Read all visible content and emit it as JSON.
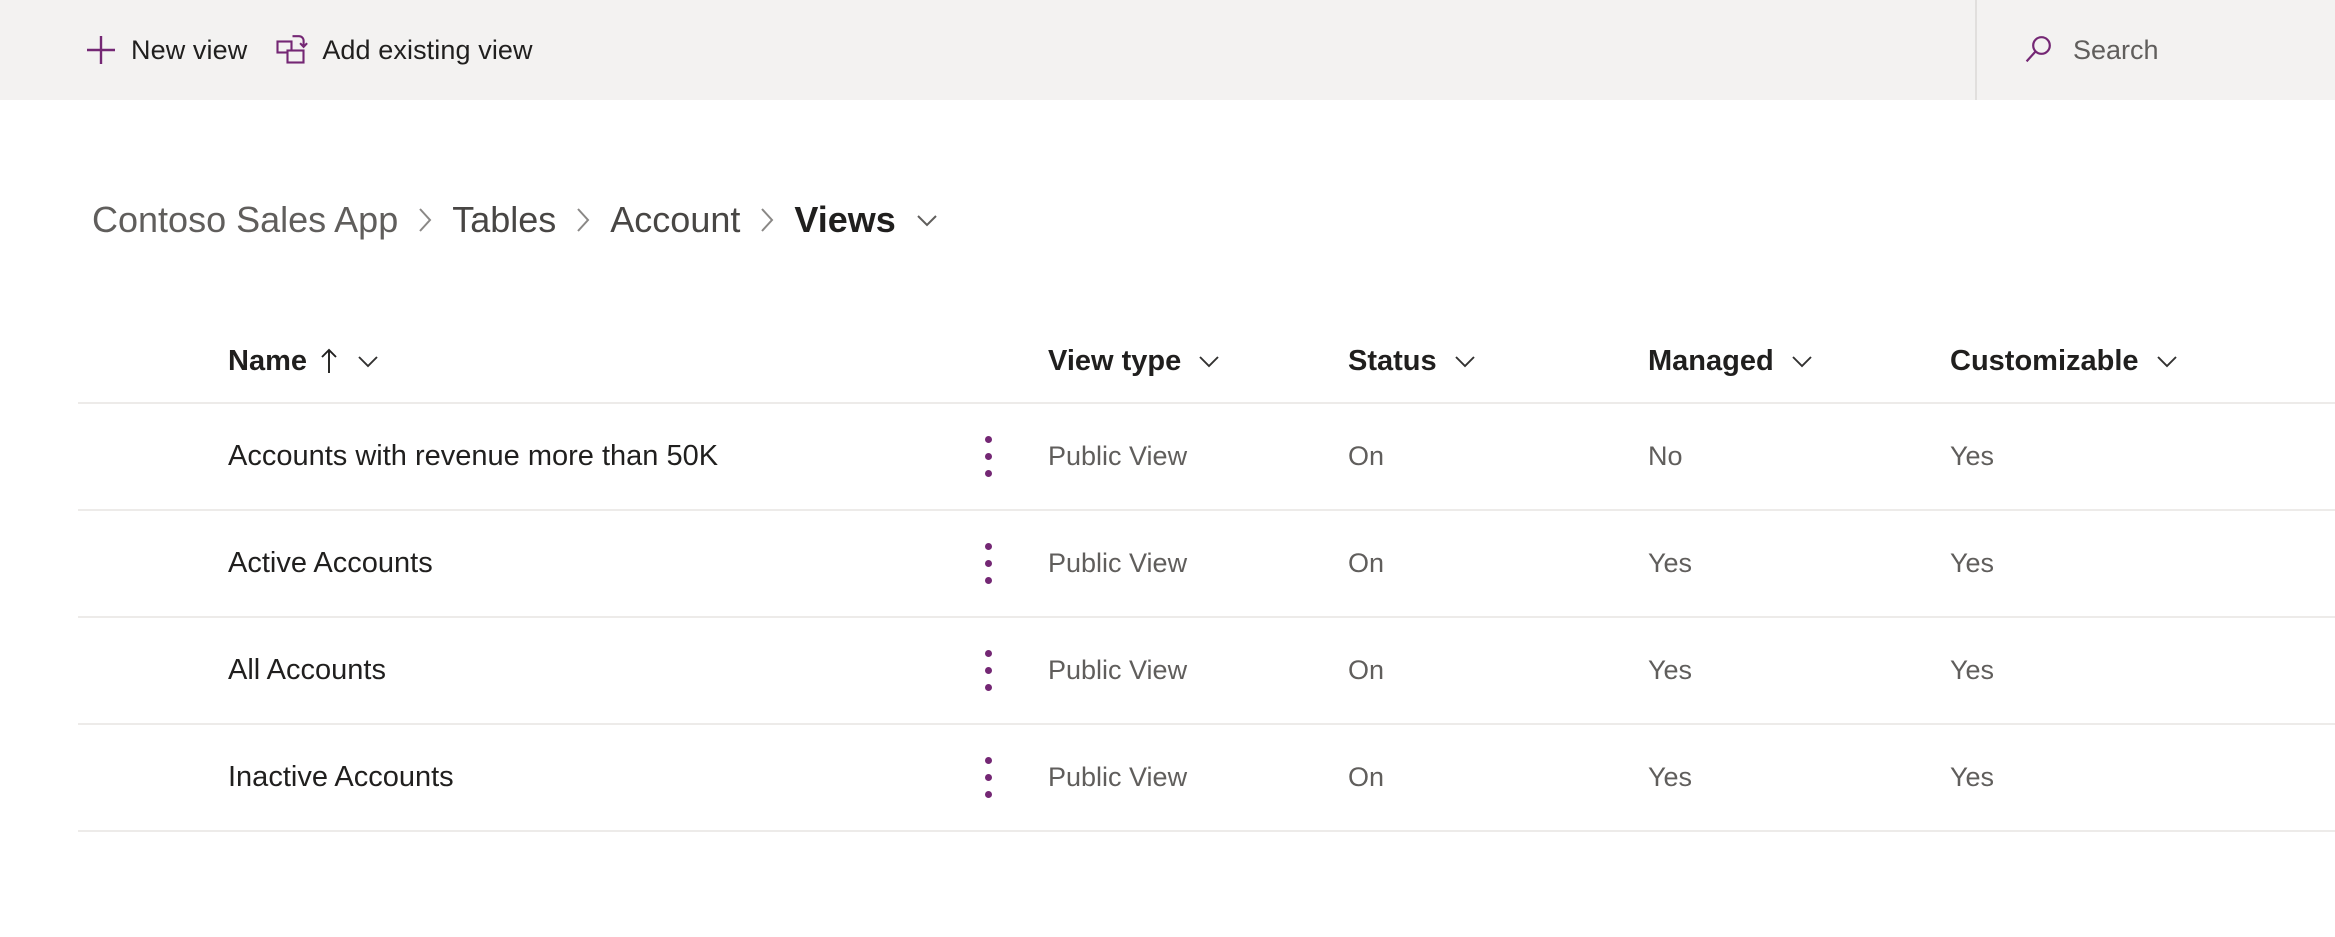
{
  "commandbar": {
    "new_view": {
      "label": "New view",
      "icon": "plus-icon"
    },
    "add_existing_view": {
      "label": "Add existing view",
      "icon": "add-existing-view-icon"
    },
    "search": {
      "placeholder": "Search",
      "value": "",
      "icon": "search-icon"
    },
    "background": "#f3f2f1",
    "accent": "#742774"
  },
  "breadcrumb": {
    "items": [
      {
        "label": "Contoso Sales App"
      },
      {
        "label": "Tables"
      },
      {
        "label": "Account"
      },
      {
        "label": "Views"
      }
    ],
    "separator": "›",
    "current_chevron": "chevron-down-icon"
  },
  "table": {
    "columns": [
      {
        "label": "Name",
        "sort": "ascending",
        "sort_icon": "arrow-up-icon",
        "chevron": "chevron-down-icon"
      },
      {
        "label": "View type",
        "chevron": "chevron-down-icon"
      },
      {
        "label": "Status",
        "chevron": "chevron-down-icon"
      },
      {
        "label": "Managed",
        "chevron": "chevron-down-icon"
      },
      {
        "label": "Customizable",
        "chevron": "chevron-down-icon"
      }
    ],
    "row_menu_icon": "more-vertical-icon",
    "rows": [
      {
        "name": "Accounts with revenue more than 50K",
        "view_type": "Public View",
        "status": "On",
        "managed": "No",
        "customizable": "Yes"
      },
      {
        "name": "Active Accounts",
        "view_type": "Public View",
        "status": "On",
        "managed": "Yes",
        "customizable": "Yes"
      },
      {
        "name": "All Accounts",
        "view_type": "Public View",
        "status": "On",
        "managed": "Yes",
        "customizable": "Yes"
      },
      {
        "name": "Inactive Accounts",
        "view_type": "Public View",
        "status": "On",
        "managed": "Yes",
        "customizable": "Yes"
      }
    ]
  }
}
